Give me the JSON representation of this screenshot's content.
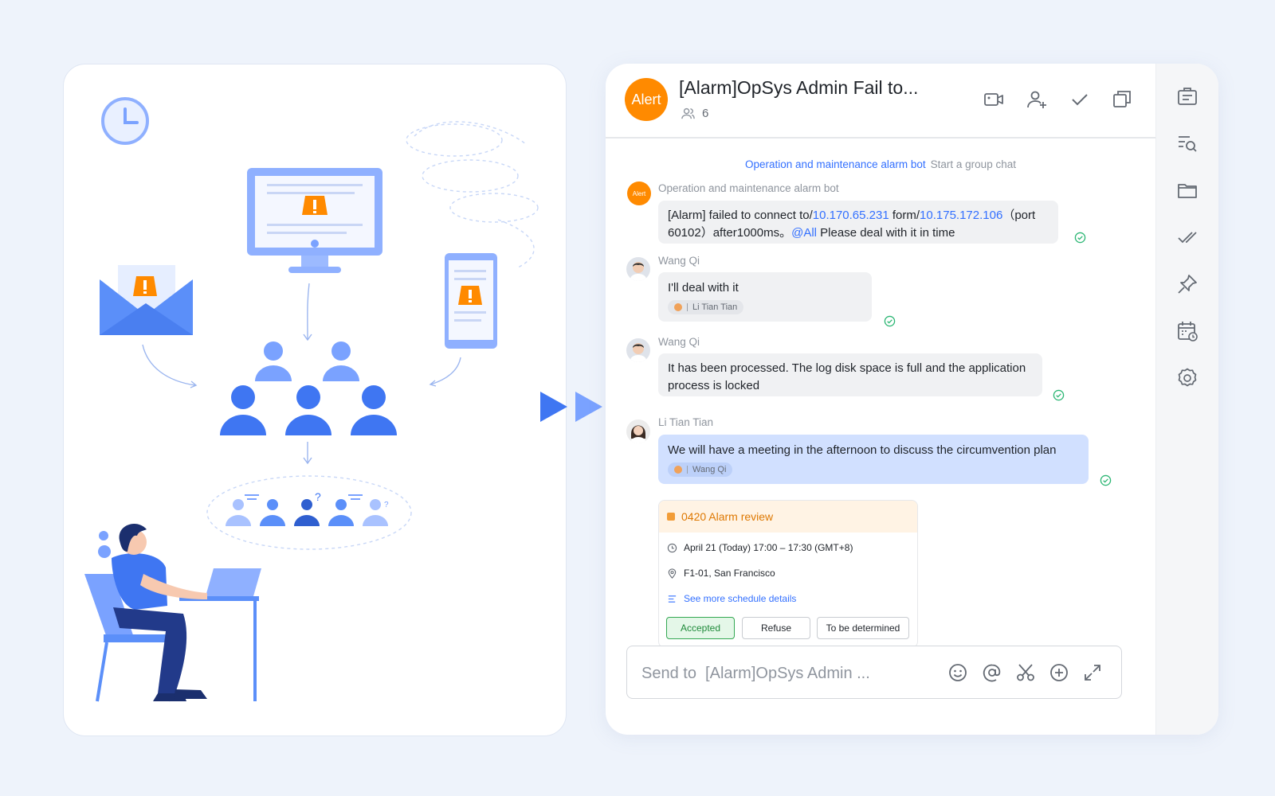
{
  "chat": {
    "avatar_label": "Alert",
    "title": "[Alarm]OpSys Admin Fail to...",
    "member_count": "6"
  },
  "system_message": {
    "bot_name": "Operation and maintenance alarm bot",
    "action": "Start a group chat"
  },
  "messages": [
    {
      "sender": "Operation and maintenance alarm bot",
      "avatar_label": "Alert",
      "parts": {
        "p1": "[Alarm] failed to connect to/",
        "ip1": "10.170.65.231",
        "p2": " form/",
        "ip2": "10.175.172.106",
        "p3": "（port 60102）after1000ms。",
        "mention": "@All",
        "p4": " Please deal with it in time"
      }
    },
    {
      "sender": "Wang Qi",
      "text": "I'll deal with it",
      "reply_to": "Li Tian Tian"
    },
    {
      "sender": "Wang Qi",
      "text": "It has been processed. The log disk space is full and the application process is locked"
    },
    {
      "sender": "Li Tian Tian",
      "text": "We will have a meeting in the afternoon to discuss the circumvention plan",
      "reply_to": "Wang Qi"
    }
  ],
  "event": {
    "title": "0420 Alarm review",
    "time": "April 21 (Today) 17:00 – 17:30 (GMT+8)",
    "location": "F1-01, San Francisco",
    "more_link": "See more schedule details",
    "buttons": {
      "accept": "Accepted",
      "refuse": "Refuse",
      "tbd": "To be determined"
    }
  },
  "composer": {
    "placeholder": "Send to  [Alarm]OpSys Admin ..."
  },
  "colors": {
    "accent": "#3370ff",
    "alert_orange": "#ff8a00",
    "read_green": "#2bb673",
    "illustration_blue": "#5b8ff9"
  },
  "icons": {
    "header": [
      "video-call-icon",
      "add-member-icon",
      "check-icon",
      "multi-window-icon"
    ],
    "rail": [
      "announcement-icon",
      "search-history-icon",
      "folder-icon",
      "done-icon",
      "pin-icon",
      "calendar-icon",
      "settings-icon"
    ],
    "composer": [
      "emoji-icon",
      "mention-icon",
      "scissors-icon",
      "plus-icon",
      "expand-icon"
    ]
  }
}
